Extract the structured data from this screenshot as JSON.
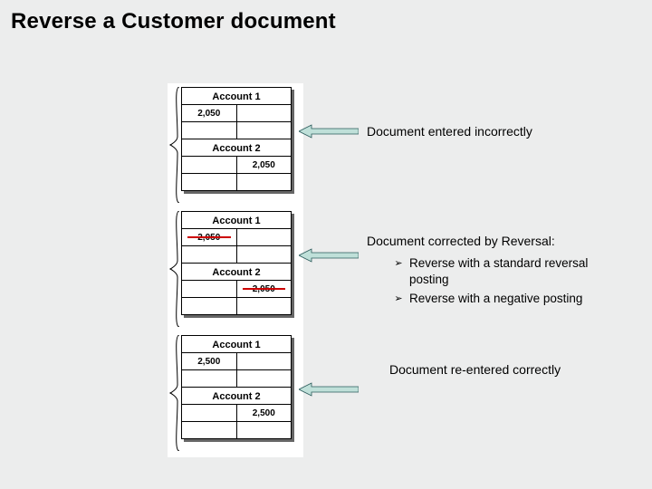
{
  "title": "Reverse a Customer document",
  "ledgers": [
    {
      "acct1": {
        "title": "Account 1",
        "left": "2,050",
        "right": ""
      },
      "acct2": {
        "title": "Account 2",
        "left": "",
        "right": "2,050"
      }
    },
    {
      "acct1": {
        "title": "Account 1",
        "left": "2,050",
        "right": ""
      },
      "acct2": {
        "title": "Account 2",
        "left": "",
        "right": "2,050"
      }
    },
    {
      "acct1": {
        "title": "Account 1",
        "left": "2,500",
        "right": ""
      },
      "acct2": {
        "title": "Account 2",
        "left": "",
        "right": "2,500"
      }
    }
  ],
  "captions": {
    "incorrect": "Document entered incorrectly",
    "reversal": "Document corrected by Reversal:",
    "reentered": "Document re-entered correctly"
  },
  "bullets": [
    "Reverse with a standard reversal posting",
    "Reverse with a negative posting"
  ],
  "bullet_symbol": "➢"
}
